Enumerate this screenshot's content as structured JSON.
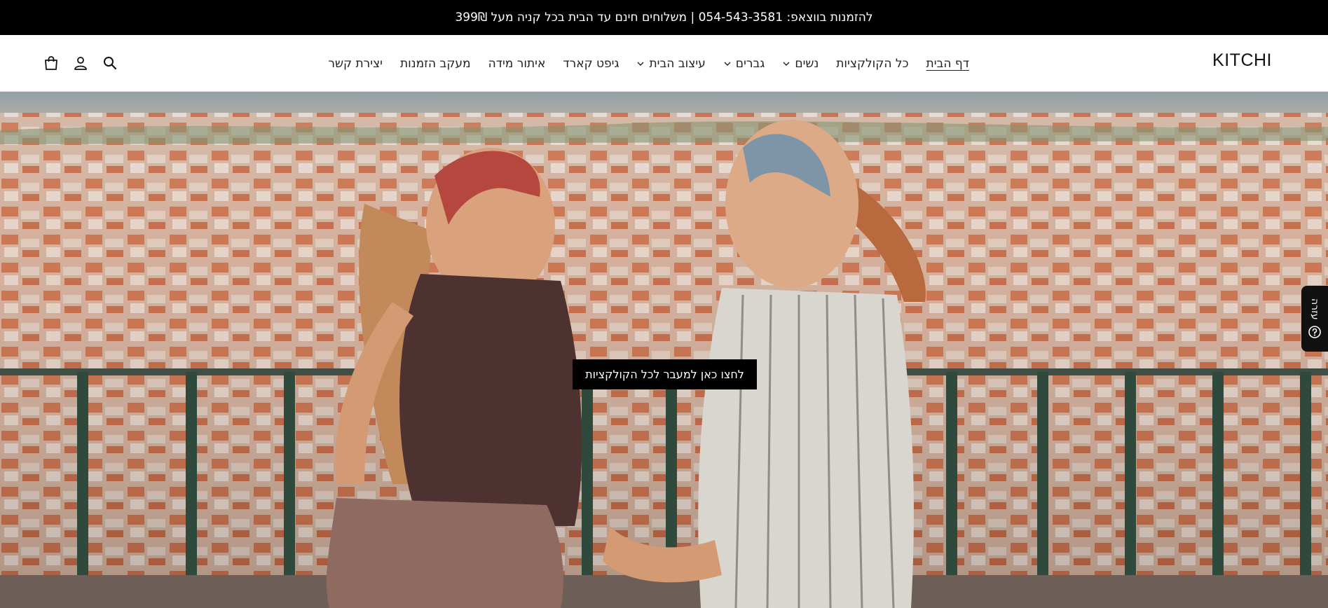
{
  "announcement": {
    "text": "להזמנות בווצאפ: 054-543-3581 | משלוחים חינם עד הבית בכל קניה מעל 399₪"
  },
  "header": {
    "logo": "KITCHI",
    "nav": [
      {
        "label": "דף הבית",
        "active": true,
        "dropdown": false
      },
      {
        "label": "כל הקולקציות",
        "active": false,
        "dropdown": false
      },
      {
        "label": "נשים",
        "active": false,
        "dropdown": true
      },
      {
        "label": "גברים",
        "active": false,
        "dropdown": true
      },
      {
        "label": "עיצוב הבית",
        "active": false,
        "dropdown": true
      },
      {
        "label": "גיפט קארד",
        "active": false,
        "dropdown": false
      },
      {
        "label": "איתור מידה",
        "active": false,
        "dropdown": false
      },
      {
        "label": "מעקב הזמנות",
        "active": false,
        "dropdown": false
      },
      {
        "label": "יצירת קשר",
        "active": false,
        "dropdown": false
      }
    ],
    "icons": [
      "search-icon",
      "account-icon",
      "cart-icon"
    ]
  },
  "hero": {
    "cta_label": "לחצו כאן למעבר לכל הקולקציות"
  },
  "help_tab": {
    "label": "עזרה",
    "icon": "help-icon"
  },
  "colors": {
    "announcement_bg": "#000000",
    "cta_bg": "#000000",
    "text": "#222222"
  }
}
